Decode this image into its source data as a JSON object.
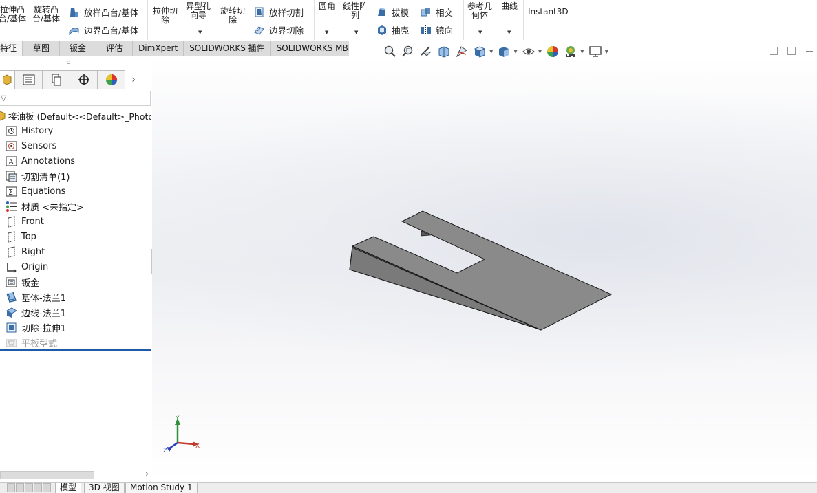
{
  "ribbon": {
    "extrude_boss": "拉伸凸\n台/基体",
    "revolve_boss": "旋转凸\n台/基体",
    "loft_boss": "放样凸台/基体",
    "boundary_boss": "边界凸台/基体",
    "extrude_cut": "拉伸切\n除",
    "hole_wizard": "异型孔\n向导",
    "revolve_cut": "旋转切\n除",
    "loft_cut": "放样切割",
    "boundary_cut": "边界切除",
    "fillet": "圆角",
    "linear_pattern": "线性阵\n列",
    "draft": "拔模",
    "shell": "抽壳",
    "intersect": "相交",
    "mirror": "镜向",
    "ref_geometry": "参考几\n何体",
    "curves": "曲线",
    "instant3d": "Instant3D"
  },
  "cm_tabs": [
    {
      "label": "特征",
      "active": true
    },
    {
      "label": "草图"
    },
    {
      "label": "钣金"
    },
    {
      "label": "评估"
    },
    {
      "label": "DimXpert"
    },
    {
      "label": "SOLIDWORKS 插件"
    },
    {
      "label": "SOLIDWORKS MBD"
    }
  ],
  "tree": {
    "root": "接油板  (Default<<Default>_PhotoWorks",
    "items": [
      {
        "label": "History",
        "icon": "history-icon"
      },
      {
        "label": "Sensors",
        "icon": "sensors-icon"
      },
      {
        "label": "Annotations",
        "icon": "annotations-icon"
      },
      {
        "label": "切割清单(1)",
        "icon": "cut-list-icon"
      },
      {
        "label": "Equations",
        "icon": "equations-icon"
      },
      {
        "label": "材质 <未指定>",
        "icon": "material-icon"
      },
      {
        "label": "Front",
        "icon": "plane-icon"
      },
      {
        "label": "Top",
        "icon": "plane-icon"
      },
      {
        "label": "Right",
        "icon": "plane-icon"
      },
      {
        "label": "Origin",
        "icon": "origin-icon"
      },
      {
        "label": "钣金",
        "icon": "sheet-metal-icon"
      },
      {
        "label": "基体-法兰1",
        "icon": "base-flange-icon"
      },
      {
        "label": "边线-法兰1",
        "icon": "edge-flange-icon"
      },
      {
        "label": "切除-拉伸1",
        "icon": "cut-extrude-icon"
      },
      {
        "label": "平板型式",
        "icon": "flat-pattern-icon",
        "suppressed": true
      }
    ]
  },
  "triad": {
    "x": "X",
    "y": "Y",
    "z": "Z"
  },
  "bottom_tabs": [
    {
      "label": "模型",
      "active": true
    },
    {
      "label": "3D 视图"
    },
    {
      "label": "Motion Study 1"
    }
  ],
  "colors": {
    "part_top": "#8a8a8a",
    "part_side": "#6e6e6e",
    "rollback_bar": "#1d5aa8"
  }
}
